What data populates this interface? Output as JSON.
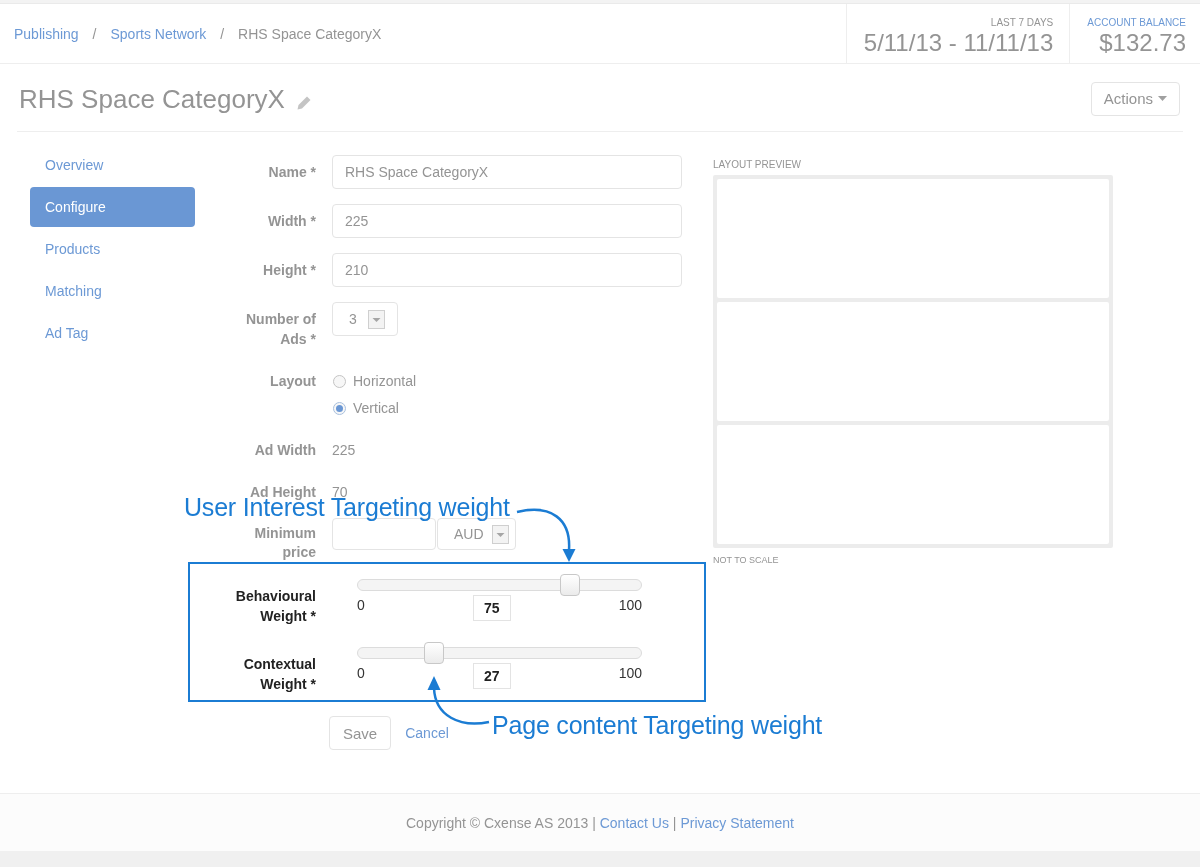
{
  "breadcrumb": {
    "separator": "/",
    "items": [
      {
        "label": "Publishing",
        "kind": "link"
      },
      {
        "label": "Sports Network",
        "kind": "link"
      },
      {
        "label": "RHS Space CategoryX",
        "kind": "current"
      }
    ]
  },
  "stats": [
    {
      "kind": "plain",
      "label": "LAST 7 DAYS",
      "value": "5/11/13 - 11/11/13"
    },
    {
      "kind": "link",
      "label": "ACCOUNT BALANCE",
      "value": "$132.73"
    }
  ],
  "page_title": "RHS Space CategoryX",
  "actions_button": "Actions",
  "sidebar": {
    "items": [
      {
        "label": "Overview",
        "selected": false
      },
      {
        "label": "Configure",
        "selected": true
      },
      {
        "label": "Products",
        "selected": false
      },
      {
        "label": "Matching",
        "selected": false
      },
      {
        "label": "Ad Tag",
        "selected": false
      }
    ]
  },
  "form": {
    "fields": [
      {
        "kind": "text",
        "label": "Name *",
        "value": "RHS Space CategoryX"
      },
      {
        "kind": "text",
        "label": "Width *",
        "value": "225"
      },
      {
        "kind": "text",
        "label": "Height *",
        "value": "210"
      },
      {
        "kind": "select",
        "label": "Number of Ads *",
        "value": "3"
      },
      {
        "kind": "radio",
        "label": "Layout",
        "options": [
          {
            "label": "Horizontal",
            "selected": false
          },
          {
            "label": "Vertical",
            "selected": true
          }
        ]
      },
      {
        "kind": "static",
        "label": "Ad Width",
        "value": "225"
      },
      {
        "kind": "static",
        "label": "Ad Height",
        "value": "70"
      },
      {
        "kind": "price",
        "label": "Minimum price",
        "currency": "AUD"
      }
    ],
    "sliders": [
      {
        "label": "Behavioural Weight *",
        "min": "0",
        "max": "100",
        "value": "75",
        "level": 0.75
      },
      {
        "label": "Contextual Weight *",
        "min": "0",
        "max": "100",
        "value": "27",
        "level": 0.27
      }
    ],
    "buttons": [
      {
        "kind": "button",
        "label": "Save"
      },
      {
        "kind": "link",
        "label": "Cancel"
      }
    ]
  },
  "preview": {
    "title": "LAYOUT PREVIEW",
    "note": "NOT TO SCALE"
  },
  "annotations": [
    {
      "kind": "above",
      "text": "User Interest Targeting weight"
    },
    {
      "kind": "below",
      "text": "Page content Targeting weight"
    }
  ],
  "footer": {
    "copyright": "Copyright © Cxense AS 2013",
    "separator": "|",
    "links": [
      "Contact Us",
      "Privacy Statement"
    ]
  }
}
